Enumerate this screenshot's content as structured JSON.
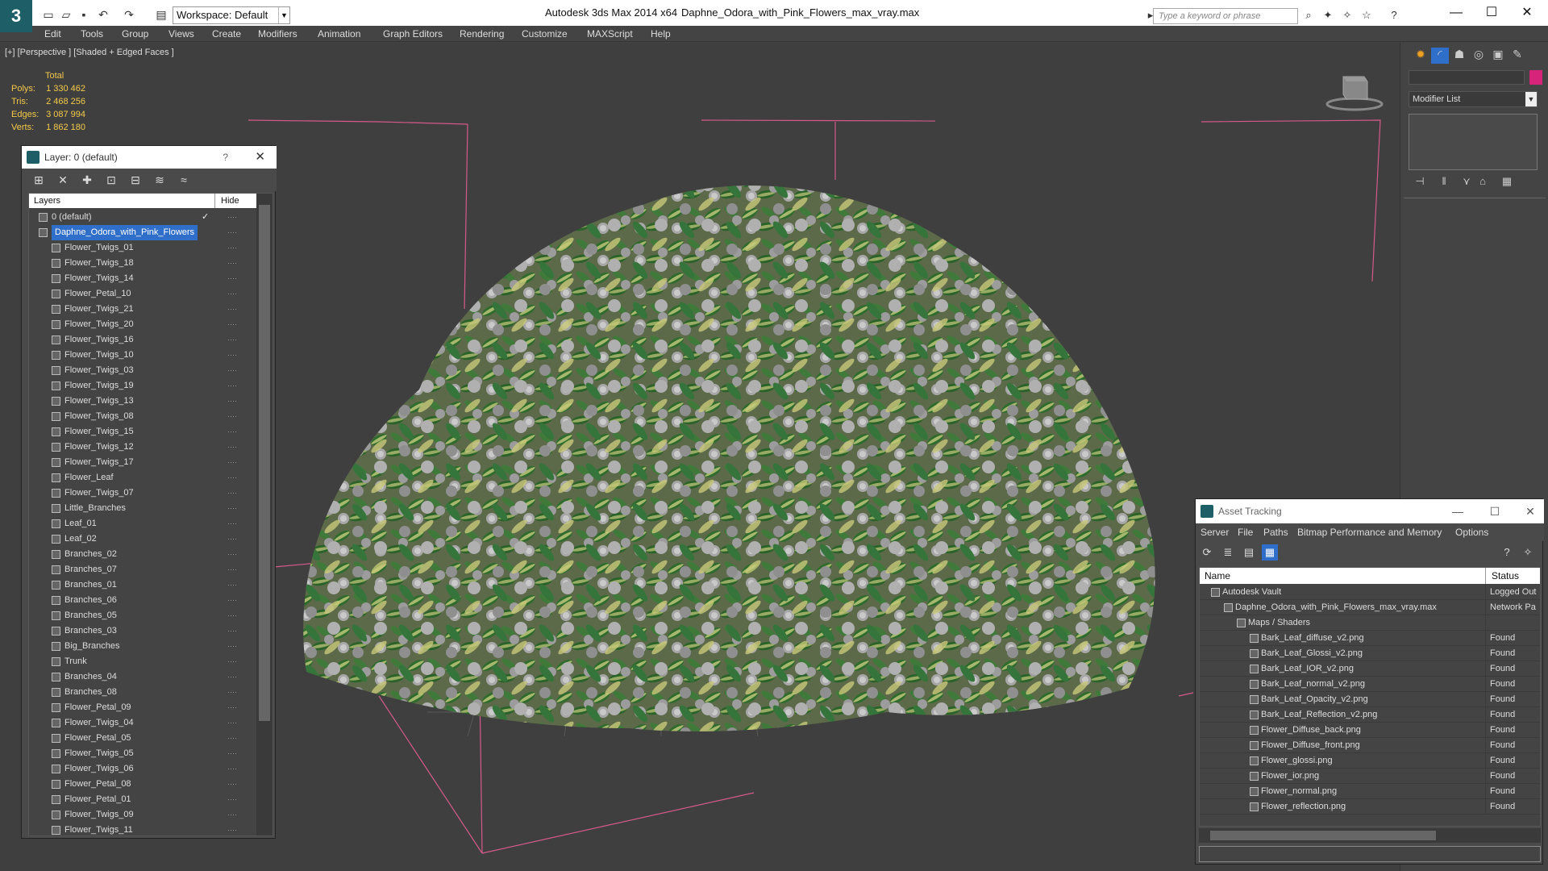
{
  "app": {
    "title": "Autodesk 3ds Max  2014 x64",
    "filename": "Daphne_Odora_with_Pink_Flowers_max_vray.max",
    "workspace": "Workspace: Default",
    "search_placeholder": "Type a keyword or phrase"
  },
  "menu": [
    "Edit",
    "Tools",
    "Group",
    "Views",
    "Create",
    "Modifiers",
    "Animation",
    "Graph Editors",
    "Rendering",
    "Customize",
    "MAXScript",
    "Help"
  ],
  "viewport": {
    "label": "[+] [Perspective ] [Shaded + Edged Faces ]",
    "stats": {
      "header": "Total",
      "polys_label": "Polys:",
      "polys": "1 330 462",
      "tris_label": "Tris:",
      "tris": "2 468 256",
      "edges_label": "Edges:",
      "edges": "3 087 994",
      "verts_label": "Verts:",
      "verts": "1 862 180"
    }
  },
  "command_panel": {
    "modifier_list": "Modifier List",
    "object_color": "#d6247a"
  },
  "layer_window": {
    "title": "Layer: 0 (default)",
    "help": "?",
    "col_layers": "Layers",
    "col_hide": "Hide",
    "rows": [
      {
        "name": "0 (default)",
        "level": 0,
        "check": "✓"
      },
      {
        "name": "Daphne_Odora_with_Pink_Flowers",
        "level": 0,
        "selected": true
      },
      {
        "name": "Flower_Twigs_01",
        "level": 1
      },
      {
        "name": "Flower_Twigs_18",
        "level": 1
      },
      {
        "name": "Flower_Twigs_14",
        "level": 1
      },
      {
        "name": "Flower_Petal_10",
        "level": 1
      },
      {
        "name": "Flower_Twigs_21",
        "level": 1
      },
      {
        "name": "Flower_Twigs_20",
        "level": 1
      },
      {
        "name": "Flower_Twigs_16",
        "level": 1
      },
      {
        "name": "Flower_Twigs_10",
        "level": 1
      },
      {
        "name": "Flower_Twigs_03",
        "level": 1
      },
      {
        "name": "Flower_Twigs_19",
        "level": 1
      },
      {
        "name": "Flower_Twigs_13",
        "level": 1
      },
      {
        "name": "Flower_Twigs_08",
        "level": 1
      },
      {
        "name": "Flower_Twigs_15",
        "level": 1
      },
      {
        "name": "Flower_Twigs_12",
        "level": 1
      },
      {
        "name": "Flower_Twigs_17",
        "level": 1
      },
      {
        "name": "Flower_Leaf",
        "level": 1
      },
      {
        "name": "Flower_Twigs_07",
        "level": 1
      },
      {
        "name": "Little_Branches",
        "level": 1
      },
      {
        "name": "Leaf_01",
        "level": 1
      },
      {
        "name": "Leaf_02",
        "level": 1
      },
      {
        "name": "Branches_02",
        "level": 1
      },
      {
        "name": "Branches_07",
        "level": 1
      },
      {
        "name": "Branches_01",
        "level": 1
      },
      {
        "name": "Branches_06",
        "level": 1
      },
      {
        "name": "Branches_05",
        "level": 1
      },
      {
        "name": "Branches_03",
        "level": 1
      },
      {
        "name": "Big_Branches",
        "level": 1
      },
      {
        "name": "Trunk",
        "level": 1
      },
      {
        "name": "Branches_04",
        "level": 1
      },
      {
        "name": "Branches_08",
        "level": 1
      },
      {
        "name": "Flower_Petal_09",
        "level": 1
      },
      {
        "name": "Flower_Twigs_04",
        "level": 1
      },
      {
        "name": "Flower_Petal_05",
        "level": 1
      },
      {
        "name": "Flower_Twigs_05",
        "level": 1
      },
      {
        "name": "Flower_Twigs_06",
        "level": 1
      },
      {
        "name": "Flower_Petal_08",
        "level": 1
      },
      {
        "name": "Flower_Petal_01",
        "level": 1
      },
      {
        "name": "Flower_Twigs_09",
        "level": 1
      },
      {
        "name": "Flower_Twigs_11",
        "level": 1
      }
    ]
  },
  "asset_tracking": {
    "title": "Asset Tracking",
    "menu": [
      "Server",
      "File",
      "Paths",
      "Bitmap Performance and Memory",
      "Options"
    ],
    "col_name": "Name",
    "col_status": "Status",
    "rows": [
      {
        "name": "Autodesk Vault",
        "level": 0,
        "status": "Logged Out"
      },
      {
        "name": "Daphne_Odora_with_Pink_Flowers_max_vray.max",
        "level": 1,
        "status": "Network Pa"
      },
      {
        "name": "Maps / Shaders",
        "level": 2,
        "status": ""
      },
      {
        "name": "Bark_Leaf_diffuse_v2.png",
        "level": 3,
        "status": "Found"
      },
      {
        "name": "Bark_Leaf_Glossi_v2.png",
        "level": 3,
        "status": "Found"
      },
      {
        "name": "Bark_Leaf_IOR_v2.png",
        "level": 3,
        "status": "Found"
      },
      {
        "name": "Bark_Leaf_normal_v2.png",
        "level": 3,
        "status": "Found"
      },
      {
        "name": "Bark_Leaf_Opacity_v2.png",
        "level": 3,
        "status": "Found"
      },
      {
        "name": "Bark_Leaf_Reflection_v2.png",
        "level": 3,
        "status": "Found"
      },
      {
        "name": "Flower_Diffuse_back.png",
        "level": 3,
        "status": "Found"
      },
      {
        "name": "Flower_Diffuse_front.png",
        "level": 3,
        "status": "Found"
      },
      {
        "name": "Flower_glossi.png",
        "level": 3,
        "status": "Found"
      },
      {
        "name": "Flower_ior.png",
        "level": 3,
        "status": "Found"
      },
      {
        "name": "Flower_normal.png",
        "level": 3,
        "status": "Found"
      },
      {
        "name": "Flower_reflection.png",
        "level": 3,
        "status": "Found"
      }
    ]
  }
}
